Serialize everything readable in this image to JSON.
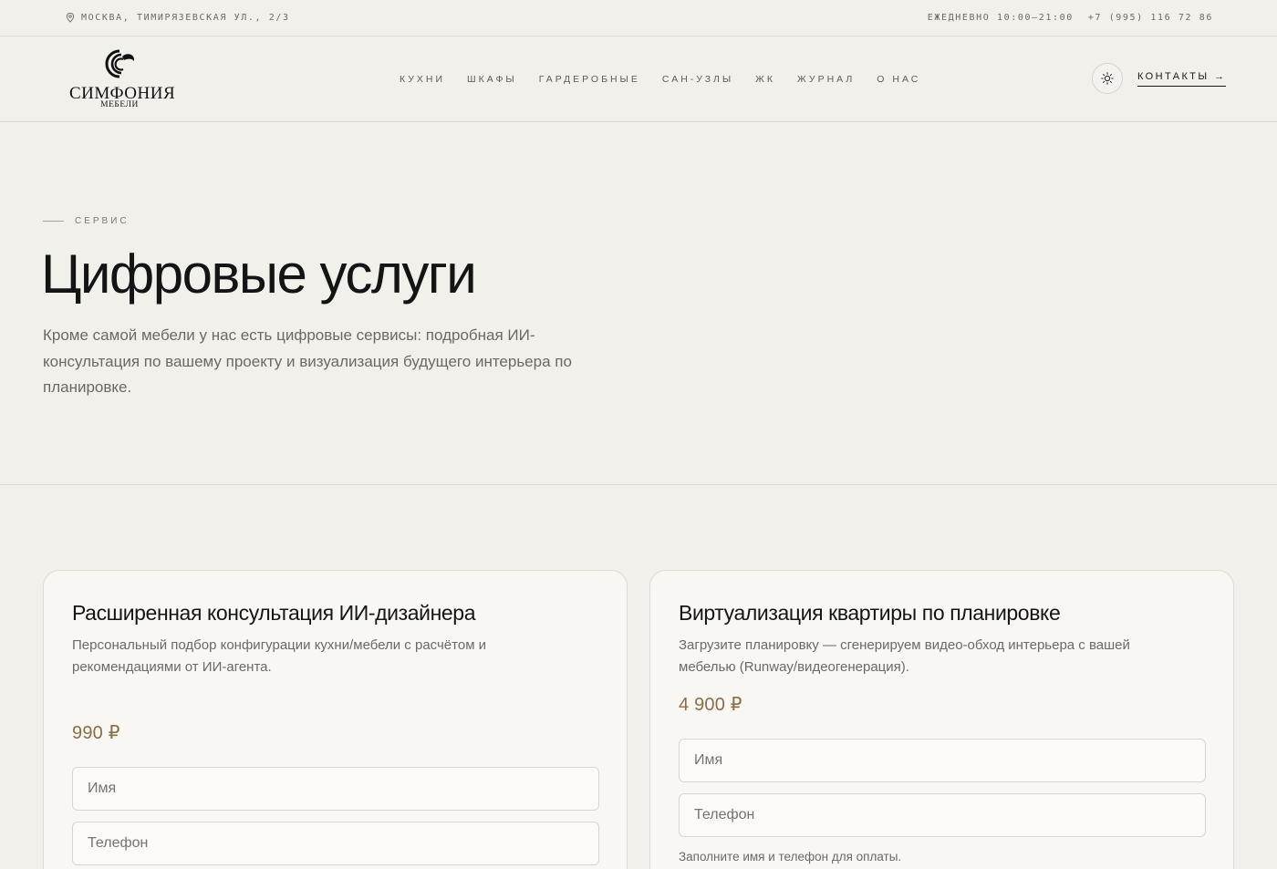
{
  "topbar": {
    "address": "МОСКВА, ТИМИРЯЗЕВСКАЯ УЛ., 2/3",
    "hours": "ЕЖЕДНЕВНО 10:00–21:00",
    "phone": "+7 (995) 116 72 86"
  },
  "header": {
    "logo_name": "СИМФОНИЯ",
    "logo_sub": "МЕБЕЛИ",
    "nav": [
      "КУХНИ",
      "ШКАФЫ",
      "ГАРДЕРОБНЫЕ",
      "САН-УЗЛЫ",
      "ЖК",
      "ЖУРНАЛ",
      "О НАС"
    ],
    "contacts_label": "КОНТАКТЫ →"
  },
  "hero": {
    "eyebrow": "СЕРВИС",
    "title": "Цифровые услуги",
    "description": "Кроме самой мебели у нас есть цифровые сервисы: подробная ИИ-консультация по вашему проекту и визуализация будущего интерьера по планировке."
  },
  "cards": [
    {
      "title": "Расширенная консультация ИИ-дизайнера",
      "description": "Персональный подбор конфигурации кухни/мебели с расчётом и рекомендациями от ИИ-агента.",
      "price": "990 ₽",
      "name_placeholder": "Имя",
      "phone_placeholder": "Телефон"
    },
    {
      "title": "Виртуализация квартиры по планировке",
      "description": "Загрузите планировку — сгенерируем видео-обход интерьера с вашей мебелью (Runway/видеогенерация).",
      "price": "4 900 ₽",
      "name_placeholder": "Имя",
      "phone_placeholder": "Телефон",
      "note": "Заполните имя и телефон для оплаты."
    }
  ],
  "colors": {
    "background": "#f2f0eb",
    "card": "#f9f7f3",
    "price_accent": "#8a6e45",
    "text": "#141414",
    "muted": "#6b6964"
  },
  "icons": {
    "address": "map-pin-icon",
    "theme": "sun-icon",
    "logo": "logo-mark-icon"
  }
}
